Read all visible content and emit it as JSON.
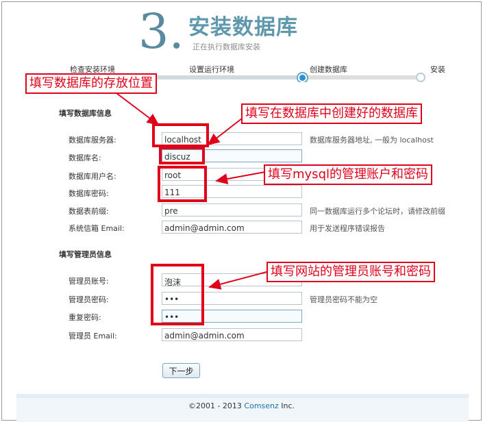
{
  "header": {
    "step_number": "3.",
    "title": "安装数据库",
    "subtitle": "正在执行数据库安装"
  },
  "progress": {
    "steps": [
      "检查安装环境",
      "设置运行环境",
      "创建数据库",
      "安装"
    ],
    "current_index": 2
  },
  "database_section": {
    "title": "填写数据库信息",
    "fields": [
      {
        "label": "数据库服务器:",
        "value": "localhost",
        "hint": "数据库服务器地址, 一般为 localhost"
      },
      {
        "label": "数据库名:",
        "value": "discuz",
        "hint": ""
      },
      {
        "label": "数据库用户名:",
        "value": "root",
        "hint": ""
      },
      {
        "label": "数据库密码:",
        "value": "111",
        "hint": ""
      },
      {
        "label": "数据表前缀:",
        "value": "pre",
        "hint": "同一数据库运行多个论坛时，请修改前缀"
      },
      {
        "label": "系统信箱 Email:",
        "value": "admin@admin.com",
        "hint": "用于发送程序错误报告"
      }
    ]
  },
  "admin_section": {
    "title": "填写管理员信息",
    "fields": [
      {
        "label": "管理员账号:",
        "value": "泡沫",
        "hint": ""
      },
      {
        "label": "管理员密码:",
        "value": "•••",
        "hint": "管理员密码不能为空"
      },
      {
        "label": "重复密码:",
        "value": "•••",
        "hint": ""
      },
      {
        "label": "管理员 Email:",
        "value": "admin@admin.com",
        "hint": ""
      }
    ]
  },
  "buttons": {
    "next_label": "下一步"
  },
  "footer": {
    "copyright_prefix": "©2001 - 2013 ",
    "brand": "Comsenz",
    "suffix": " Inc."
  },
  "annotations": {
    "db_location": "填写数据库的存放位置",
    "db_created": "填写在数据库中创建好的数据库",
    "mysql_account": "填写mysql的管理账户和密码",
    "site_admin": "填写网站的管理员账号和密码",
    "color": "#e0001a"
  },
  "colors": {
    "title": "#5f97ad",
    "brand": "#1a6fb0",
    "annotation": "#e0001a"
  }
}
